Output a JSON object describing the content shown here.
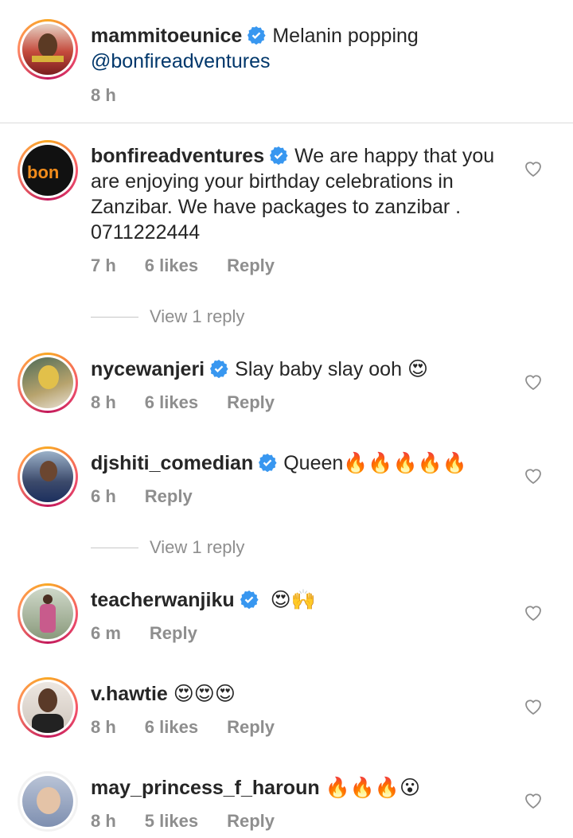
{
  "comments": [
    {
      "username": "mammitoeunice",
      "text": "Melanin popping",
      "mention": "@bonfireadventures",
      "time": "8 h",
      "likes": "",
      "reply": ""
    },
    {
      "username": "bonfireadventures",
      "text": "We are happy that you are enjoying your birthday celebrations in Zanzibar. We have packages to zanzibar . 0711222444",
      "time": "7 h",
      "likes": "6 likes",
      "reply": "Reply",
      "view_reply": "View 1 reply"
    },
    {
      "username": "nycewanjeri",
      "text": "Slay baby slay ooh",
      "emoji": "😍",
      "time": "8 h",
      "likes": "6 likes",
      "reply": "Reply"
    },
    {
      "username": "djshiti_comedian",
      "text": "Queen",
      "emoji": "🔥🔥🔥🔥🔥",
      "time": "6 h",
      "reply": "Reply",
      "view_reply": "View 1 reply"
    },
    {
      "username": "teacherwanjiku",
      "emoji": "😍🙌",
      "time": "6 m",
      "reply": "Reply"
    },
    {
      "username": "v.hawtie",
      "emoji": "😍😍😍",
      "time": "8 h",
      "likes": "6 likes",
      "reply": "Reply"
    },
    {
      "username": "may_princess_f_haroun",
      "emoji": "🔥🔥🔥😮",
      "time": "8 h",
      "likes": "5 likes",
      "reply": "Reply"
    }
  ],
  "colors": {
    "verified": "#3897f0",
    "meta": "#8e8e8e",
    "mention": "#00376b"
  },
  "icons": {
    "verified": "verified-badge-icon",
    "heart": "heart-outline-icon"
  }
}
